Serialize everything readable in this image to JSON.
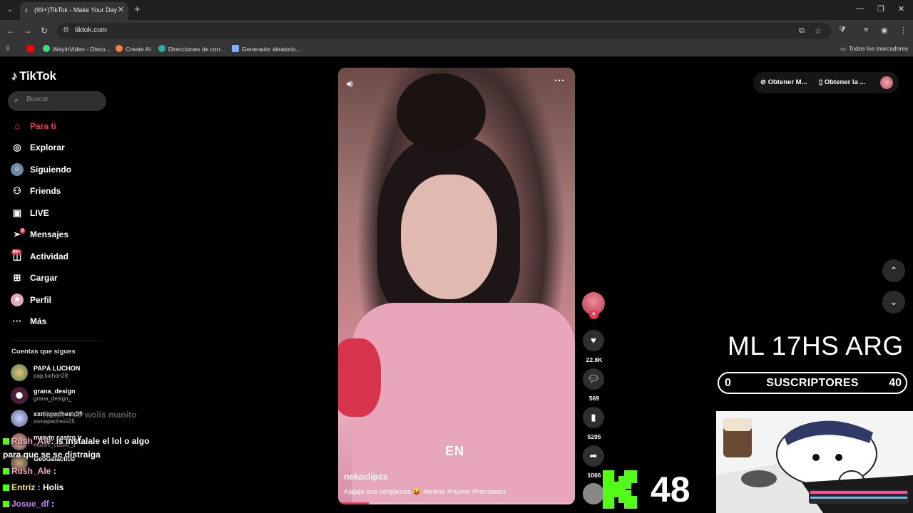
{
  "browser": {
    "tab_title": "(99+)TikTok - Make Your Day",
    "url": "tiktok.com",
    "bookmarks": [
      "WayinVideo - Disco...",
      "Create AI",
      "Direcciones de corr...",
      "Generador aleatorio..."
    ],
    "all_bookmarks": "Todos los marcadores"
  },
  "sidebar": {
    "logo": "TikTok",
    "search_placeholder": "Buscar",
    "nav": [
      {
        "label": "Para ti",
        "icon": "home-icon"
      },
      {
        "label": "Explorar",
        "icon": "compass-icon"
      },
      {
        "label": "Siguiendo",
        "icon": "following-icon"
      },
      {
        "label": "Friends",
        "icon": "friends-icon"
      },
      {
        "label": "LIVE",
        "icon": "live-icon"
      },
      {
        "label": "Mensajes",
        "icon": "messages-icon",
        "badge": "8"
      },
      {
        "label": "Actividad",
        "icon": "activity-icon",
        "badge": "99+"
      },
      {
        "label": "Cargar",
        "icon": "upload-icon"
      },
      {
        "label": "Perfil",
        "icon": "profile-icon"
      },
      {
        "label": "Más",
        "icon": "more-icon"
      }
    ],
    "following_title": "Cuentas que sigues",
    "following": [
      {
        "name": "PAPÁ LUCHON",
        "handle": "pap.luchon28"
      },
      {
        "name": "grana_design",
        "handle": "grana_design_"
      },
      {
        "name": "xxmapachexx25",
        "handle": "xxmapachexx25"
      },
      {
        "name": "marvin castro jr",
        "handle": "marvin_castro_jr"
      },
      {
        "name": "GeoGalactico",
        "handle": ""
      }
    ]
  },
  "video": {
    "username": "nekaclipss",
    "description": "Ajajaja que vergüenza 😝 #anime #humor #hermanos",
    "caption_overlay": "EN",
    "progress": 0.13
  },
  "actions": {
    "likes": "22.8K",
    "comments": "569",
    "saves": "5295",
    "shares": "1066"
  },
  "top_right": {
    "get_app_1": "Obtener M...",
    "get_app_2": "Obtener la ..."
  },
  "stream_overlay": {
    "title": "ML 17HS ARG",
    "subs_current": "0",
    "subs_label": "SUSCRIPTORES",
    "subs_goal": "40",
    "kick_viewers": "48"
  },
  "chat": [
    {
      "user": "Rush_Ale",
      "msg": "wolis manito",
      "ghost": true
    },
    {
      "user": "Rush_Ale",
      "msg": ": is instalale el lol o algo"
    },
    {
      "user": "",
      "msg": "para que se se distraiga"
    },
    {
      "user": "Rush_Ale",
      "msg": ":"
    },
    {
      "user": "Entriz",
      "msg": ": Holis"
    },
    {
      "user": "Josue_df",
      "msg": ":"
    }
  ],
  "colors": {
    "accent": "#fe2c55",
    "kick_green": "#53fc18"
  }
}
